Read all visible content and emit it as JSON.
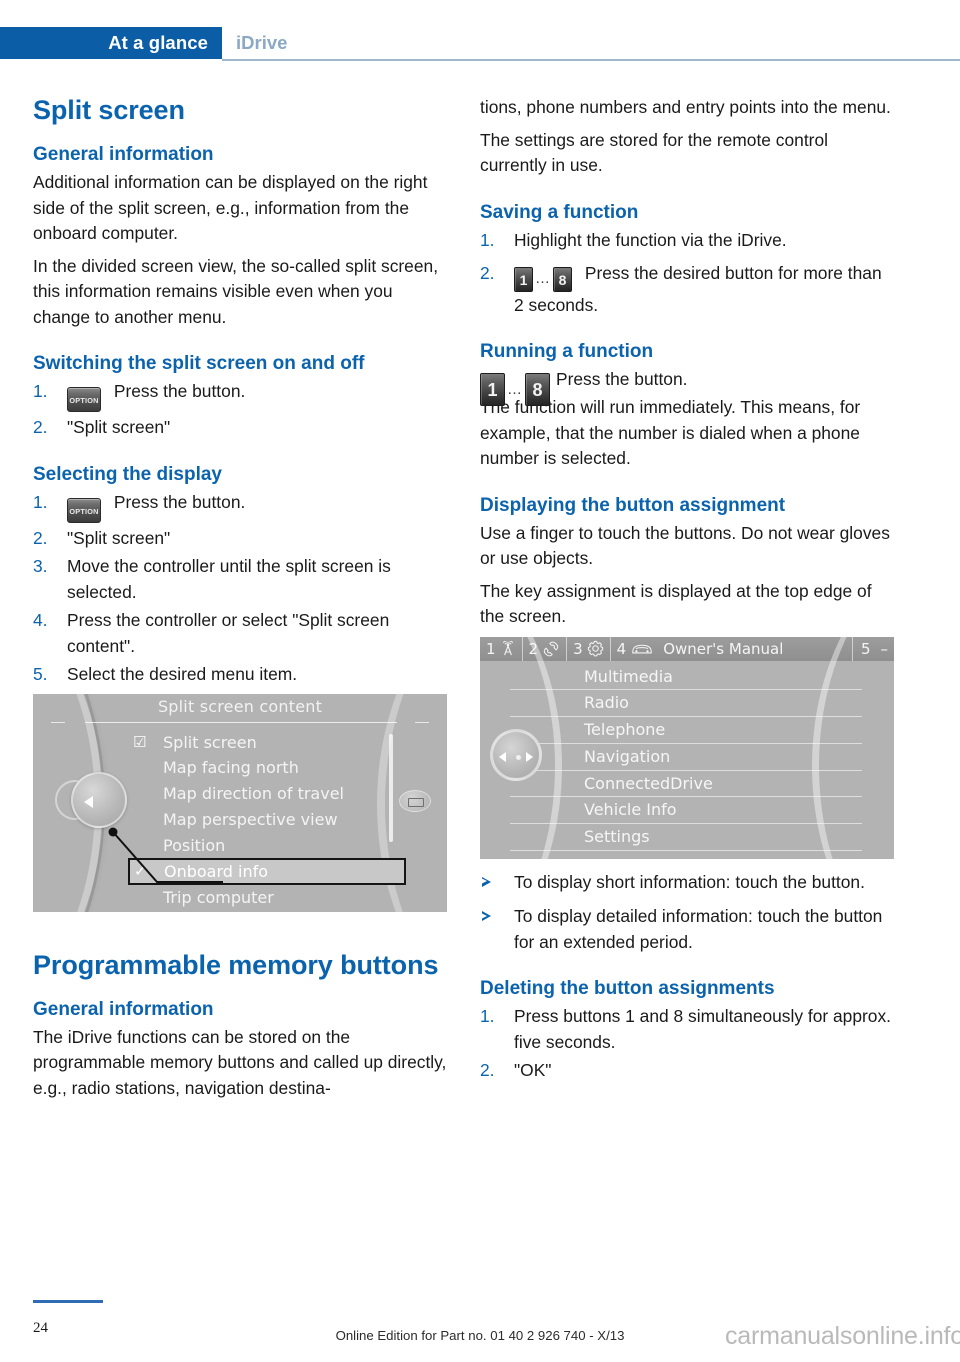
{
  "header": {
    "active_tab": "At a glance",
    "inactive_tab": "iDrive"
  },
  "left": {
    "title": "Split screen",
    "general_information_heading": "General information",
    "p1": "Additional information can be displayed on the right side of the split screen, e.g., information from the onboard computer.",
    "p2": "In the divided screen view, the so-called split screen, this information remains visible even when you change to another menu.",
    "switching_heading": "Switching the split screen on and off",
    "switching_steps": [
      {
        "num": "1.",
        "icon": "option-button-icon",
        "text": "Press the button."
      },
      {
        "num": "2.",
        "text": "\"Split screen\""
      }
    ],
    "selecting_heading": "Selecting the display",
    "selecting_steps": [
      {
        "num": "1.",
        "icon": "option-button-icon",
        "text": "Press the button."
      },
      {
        "num": "2.",
        "text": "\"Split screen\""
      },
      {
        "num": "3.",
        "text": "Move the controller until the split screen is selected."
      },
      {
        "num": "4.",
        "text": "Press the controller or select \"Split screen content\"."
      },
      {
        "num": "5.",
        "text": "Select the desired menu item."
      }
    ],
    "screenshot": {
      "title": "Split screen content",
      "items": [
        {
          "label": "Split screen",
          "mark": "checkbox-checked",
          "selected": false
        },
        {
          "label": "Map facing north",
          "mark": "",
          "selected": false
        },
        {
          "label": "Map direction of travel",
          "mark": "",
          "selected": false
        },
        {
          "label": "Map perspective view",
          "mark": "",
          "selected": false
        },
        {
          "label": "Position",
          "mark": "",
          "selected": false
        },
        {
          "label": "Onboard info",
          "mark": "check",
          "selected": true
        },
        {
          "label": "Trip computer",
          "mark": "",
          "selected": false
        }
      ]
    },
    "title2": "Programmable memory buttons",
    "general_information_heading2": "General information",
    "p3": "The iDrive functions can be stored on the programmable memory buttons and called up directly, e.g., radio stations, navigation destina-"
  },
  "right": {
    "p1": "tions, phone numbers and entry points into the menu.",
    "p2": "The settings are stored for the remote control currently in use.",
    "saving_heading": "Saving a function",
    "saving_steps": [
      {
        "num": "1.",
        "text": "Highlight the function via the iDrive."
      },
      {
        "num": "2.",
        "icon": "memory-buttons-1-8-icon",
        "text": "Press the desired button for more than 2 seconds."
      }
    ],
    "running_heading": "Running a function",
    "running_line1": "Press the button.",
    "running_line2": "The function will run immediately. This means, for example, that the number is dialed when a phone number is selected.",
    "displaying_heading": "Displaying the button assignment",
    "p3": "Use a finger to touch the buttons. Do not wear gloves or use objects.",
    "p4": "The key assignment is displayed at the top edge of the screen.",
    "screenshot": {
      "slots": [
        {
          "num": "1",
          "icon": "radio-tower-icon"
        },
        {
          "num": "2",
          "icon": "phone-handset-icon"
        },
        {
          "num": "3",
          "icon": "gear-icon"
        },
        {
          "num": "4",
          "icon": "car-front-icon",
          "name": "Owner's Manual"
        },
        {
          "num": "5",
          "icon": "dash-icon"
        }
      ],
      "items": [
        "Multimedia",
        "Radio",
        "Telephone",
        "Navigation",
        "ConnectedDrive",
        "Vehicle Info",
        "Settings"
      ]
    },
    "bullets": [
      "To display short information: touch the button.",
      "To display detailed information: touch the button for an extended period."
    ],
    "deleting_heading": "Deleting the button assignments",
    "deleting_steps": [
      {
        "num": "1.",
        "text": "Press buttons 1 and 8 simultaneously for approx. five seconds."
      },
      {
        "num": "2.",
        "text": "\"OK\""
      }
    ]
  },
  "memory_keys": {
    "first": "1",
    "dots": "…",
    "last": "8"
  },
  "option_button_label": "OPTION",
  "footer": {
    "page_number": "24",
    "center_text": "Online Edition for Part no. 01 40 2 926 740 - X/13",
    "watermark": "carmanualsonline.info"
  },
  "colors": {
    "brand_blue": "#0b63ad",
    "tab_blue": "#0b5ea6",
    "inactive_tab": "#8ba8c4"
  }
}
